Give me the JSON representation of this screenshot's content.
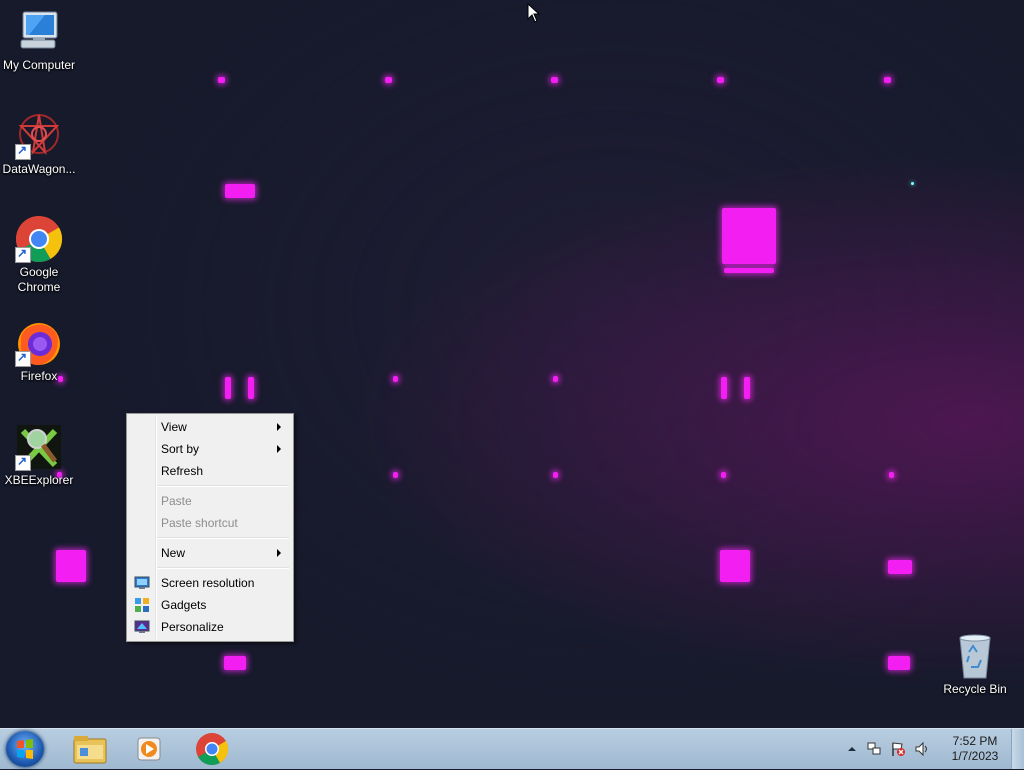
{
  "desktop": {
    "icons": [
      {
        "label": "My Computer",
        "icon": "computer-icon"
      },
      {
        "label": "DataWagon...",
        "icon": "datawagon-icon"
      },
      {
        "label": "Google Chrome",
        "icon": "chrome-icon"
      },
      {
        "label": "Firefox",
        "icon": "firefox-icon"
      },
      {
        "label": "XBEExplorer",
        "icon": "xbeexplorer-icon"
      },
      {
        "label": "Recycle Bin",
        "icon": "recycle-bin-icon"
      }
    ]
  },
  "context_menu": {
    "items": [
      {
        "label": "View",
        "submenu": true,
        "enabled": true
      },
      {
        "label": "Sort by",
        "submenu": true,
        "enabled": true
      },
      {
        "label": "Refresh",
        "submenu": false,
        "enabled": true
      },
      {
        "label": "Paste",
        "submenu": false,
        "enabled": false
      },
      {
        "label": "Paste shortcut",
        "submenu": false,
        "enabled": false
      },
      {
        "label": "New",
        "submenu": true,
        "enabled": true
      },
      {
        "label": "Screen resolution",
        "submenu": false,
        "enabled": true,
        "icon": "screen-resolution-icon"
      },
      {
        "label": "Gadgets",
        "submenu": false,
        "enabled": true,
        "icon": "gadgets-icon"
      },
      {
        "label": "Personalize",
        "submenu": false,
        "enabled": true,
        "icon": "personalize-icon"
      }
    ]
  },
  "taskbar": {
    "pinned": [
      {
        "icon": "windows-explorer-icon"
      },
      {
        "icon": "media-player-icon"
      },
      {
        "icon": "chrome-icon"
      }
    ],
    "clock": {
      "time": "7:52 PM",
      "date": "1/7/2023"
    }
  },
  "colors": {
    "wallpaper_bg": "#161a2b",
    "wallpaper_accent": "#f21ef2",
    "taskbar": "#aec4da"
  }
}
